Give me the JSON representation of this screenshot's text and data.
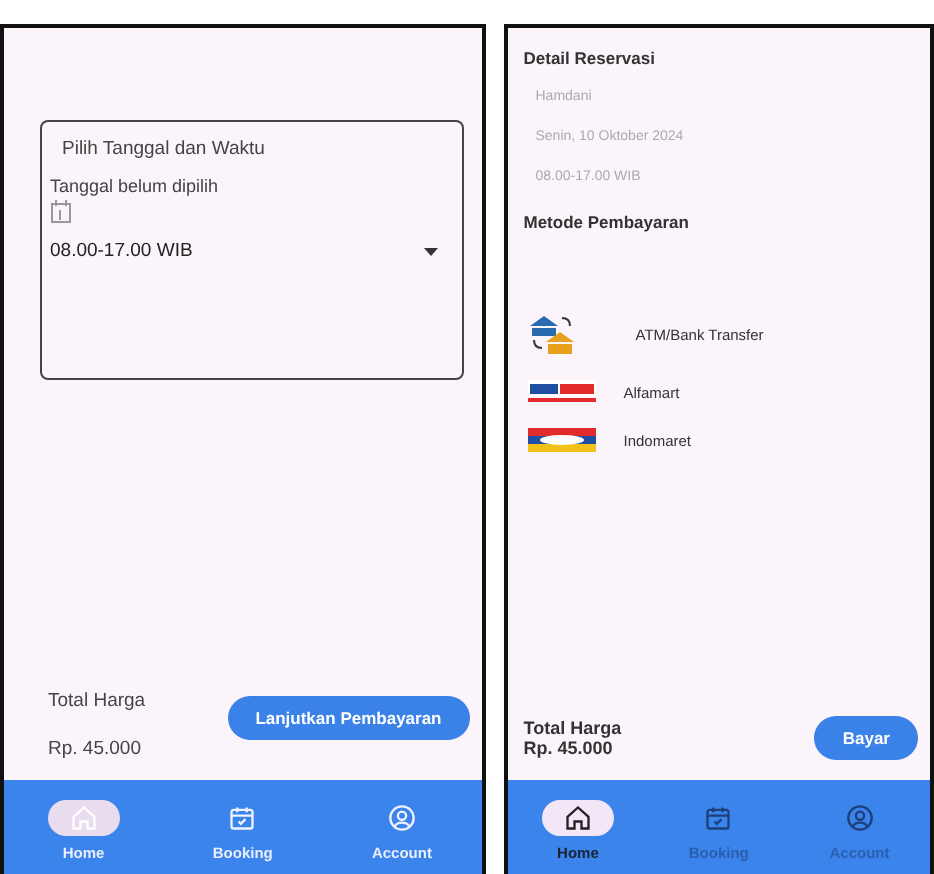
{
  "screens": [
    {
      "kind": "schedule",
      "card": {
        "title": "Pilih Tanggal dan Waktu",
        "date_label": "Tanggal belum dipilih",
        "time_value": "08.00-17.00 WIB"
      },
      "footer": {
        "label": "Total Harga",
        "price": "Rp. 45.000",
        "button": "Lanjutkan Pembayaran"
      },
      "nav": {
        "kind": "light",
        "items": [
          {
            "label": "Home",
            "selected": true
          },
          {
            "label": "Booking",
            "selected": false
          },
          {
            "label": "Account",
            "selected": false
          }
        ]
      }
    },
    {
      "kind": "payment",
      "detail_title": "Detail Reservasi",
      "details": [
        "Hamdani",
        "Senin, 10 Oktober 2024",
        "08.00-17.00 WIB"
      ],
      "methods_title": "Metode Pembayaran",
      "methods": [
        {
          "kind": "bank",
          "label": "ATM/Bank Transfer"
        },
        {
          "kind": "alfamart",
          "label": "Alfamart"
        },
        {
          "kind": "indomaret",
          "label": "Indomaret"
        }
      ],
      "footer": {
        "label": "Total Harga",
        "price": "Rp. 45.000",
        "button": "Bayar"
      },
      "nav": {
        "kind": "dark",
        "items": [
          {
            "label": "Home",
            "selected": true
          },
          {
            "label": "Booking",
            "selected": false
          },
          {
            "label": "Account",
            "selected": false
          }
        ]
      }
    }
  ]
}
